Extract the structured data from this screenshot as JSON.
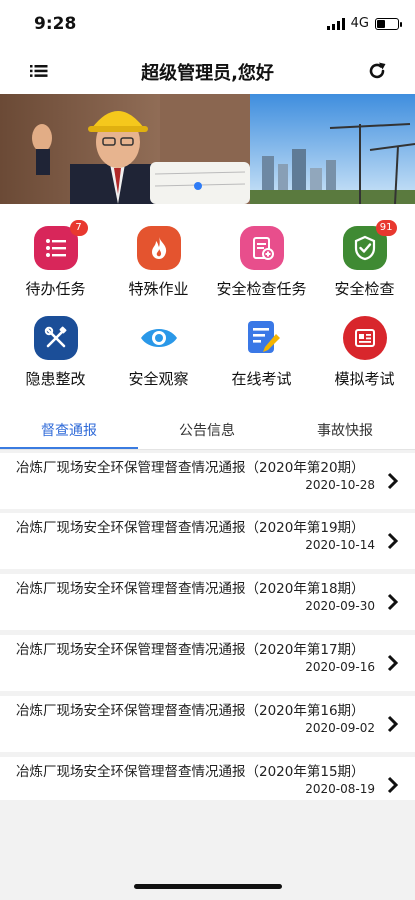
{
  "status": {
    "time": "9:28",
    "network": "4G"
  },
  "nav": {
    "title": "超级管理员,您好"
  },
  "grid": [
    {
      "label": "待办任务",
      "icon": "task-list-icon",
      "color": "#d8265a",
      "badge": "7"
    },
    {
      "label": "特殊作业",
      "icon": "fire-icon",
      "color": "#e4542f",
      "badge": ""
    },
    {
      "label": "安全检查任务",
      "icon": "checklist-doc-icon",
      "color": "#e84e8c",
      "badge": ""
    },
    {
      "label": "安全检查",
      "icon": "shield-check-icon",
      "color": "#3f8a33",
      "badge": "91"
    },
    {
      "label": "隐患整改",
      "icon": "tools-icon",
      "color": "#1b4e98",
      "badge": ""
    },
    {
      "label": "安全观察",
      "icon": "eye-icon",
      "color": "#2a98e8",
      "badge": ""
    },
    {
      "label": "在线考试",
      "icon": "exam-pen-icon",
      "color": "#3a78e6",
      "badge": ""
    },
    {
      "label": "模拟考试",
      "icon": "newspaper-icon",
      "color": "#d8262c",
      "badge": ""
    }
  ],
  "tabs": [
    "督查通报",
    "公告信息",
    "事故快报"
  ],
  "notices": [
    {
      "title": "冶炼厂现场安全环保管理督查情况通报（2020年第20期）",
      "date": "2020-10-28"
    },
    {
      "title": "冶炼厂现场安全环保管理督查情况通报（2020年第19期）",
      "date": "2020-10-14"
    },
    {
      "title": "冶炼厂现场安全环保管理督查情况通报（2020年第18期）",
      "date": "2020-09-30"
    },
    {
      "title": "冶炼厂现场安全环保管理督查情况通报（2020年第17期）",
      "date": "2020-09-16"
    },
    {
      "title": "冶炼厂现场安全环保管理督查情况通报（2020年第16期）",
      "date": "2020-09-02"
    },
    {
      "title": "冶炼厂现场安全环保管理督查情况通报（2020年第15期）",
      "date": "2020-08-19"
    }
  ]
}
